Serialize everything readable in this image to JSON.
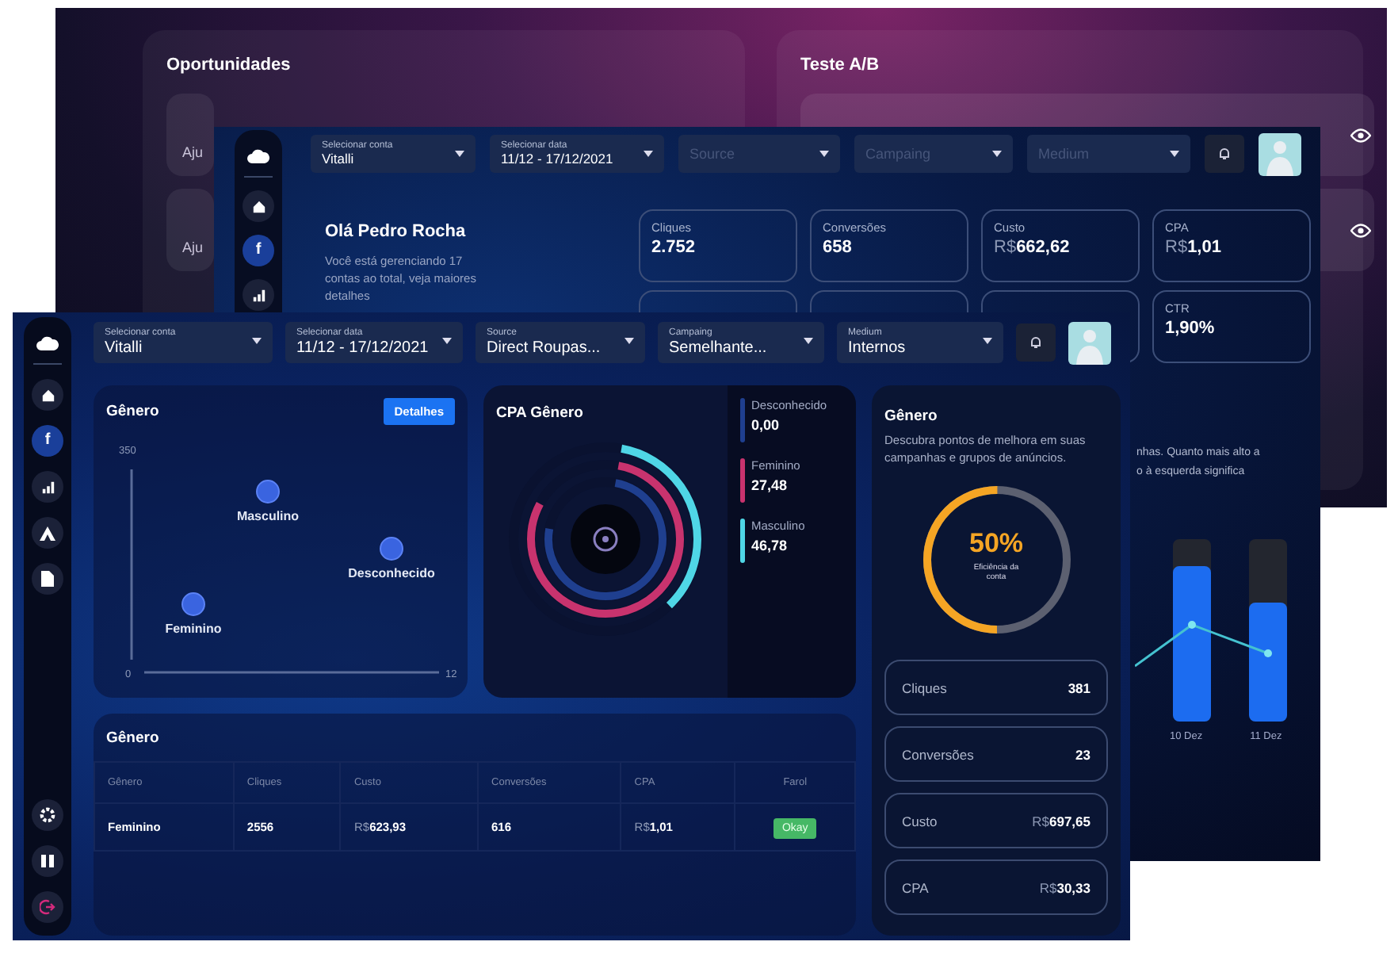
{
  "back_window": {
    "opportunities": {
      "title": "Oportunidades",
      "items": [
        {
          "text": "Aju"
        },
        {
          "text": "Aju"
        }
      ]
    },
    "ab_test": {
      "title": "Teste A/B"
    }
  },
  "middle_window": {
    "sidebar": [
      {
        "kind": "home",
        "selected": false
      },
      {
        "kind": "facebook",
        "glyph": "f",
        "selected": true
      },
      {
        "kind": "chart",
        "selected": false
      }
    ],
    "filters": [
      {
        "label": "Selecionar conta",
        "value": "Vitalli"
      },
      {
        "label": "Selecionar data",
        "value": "11/12 - 17/12/2021"
      },
      {
        "placeholder": "Source"
      },
      {
        "placeholder": "Campaing"
      },
      {
        "placeholder": "Medium"
      }
    ],
    "greeting": {
      "title": "Olá Pedro Rocha",
      "text": "Você está gerenciando 17 contas ao total, veja maiores detalhes"
    },
    "stats": [
      {
        "label": "Cliques",
        "value": "2.752"
      },
      {
        "label": "Conversões",
        "value": "658"
      },
      {
        "label": "Custo",
        "currency": "R$",
        "value": "662,62"
      },
      {
        "label": "CPA",
        "currency": "R$",
        "value": "1,01"
      },
      {
        "label": "CTR",
        "value": "1,90%"
      }
    ],
    "chart_note": [
      "nhas. Quanto mais alto a",
      "o à esquerda significa"
    ],
    "bar_labels": [
      "10 Dez",
      "11 Dez"
    ]
  },
  "front_window": {
    "sidebar": [
      {
        "kind": "home",
        "selected": false
      },
      {
        "kind": "facebook",
        "glyph": "f",
        "selected": true
      },
      {
        "kind": "chart",
        "selected": false
      },
      {
        "kind": "ads",
        "selected": false
      },
      {
        "kind": "document",
        "selected": false
      }
    ],
    "sidebar_bottom": [
      {
        "kind": "settings"
      },
      {
        "kind": "pause"
      },
      {
        "kind": "logout"
      }
    ],
    "filters": [
      {
        "label": "Selecionar conta",
        "value": "Vitalli"
      },
      {
        "label": "Selecionar data",
        "value": "11/12 - 17/12/2021"
      },
      {
        "label": "Source",
        "value": "Direct Roupas..."
      },
      {
        "label": "Campaing",
        "value": "Semelhante..."
      },
      {
        "label": "Medium",
        "value": "Internos"
      }
    ],
    "scatter_panel": {
      "title": "Gênero",
      "button": "Detalhes",
      "axis_labels": [
        "350",
        "0",
        "12"
      ],
      "points": [
        {
          "label": "Masculino"
        },
        {
          "label": "Desconhecido"
        },
        {
          "label": "Feminino"
        }
      ]
    },
    "cpa_panel": {
      "title": "CPA Gênero",
      "legend": [
        {
          "name": "Desconhecido",
          "value": "0,00",
          "color": "#1f3f8f"
        },
        {
          "name": "Feminino",
          "value": "27,48",
          "color": "#c8336e"
        },
        {
          "name": "Masculino",
          "value": "46,78",
          "color": "#4fd6e6"
        }
      ]
    },
    "summary_panel": {
      "title": "Gênero",
      "text": "Descubra pontos de melhora em suas campanhas e grupos de anúncios.",
      "gauge": {
        "level": 0.5,
        "value": "50%",
        "caption": "Eficiência da conta"
      },
      "metrics": [
        {
          "label": "Cliques",
          "value": "381"
        },
        {
          "label": "Conversões",
          "value": "23"
        },
        {
          "label": "Custo",
          "currency": "R$",
          "value": "697,65"
        },
        {
          "label": "CPA",
          "currency": "R$",
          "value": "30,33"
        }
      ]
    },
    "table": {
      "title": "Gênero",
      "columns": [
        "Gênero",
        "Cliques",
        "Custo",
        "Conversões",
        "CPA",
        "Farol"
      ],
      "rows": [
        {
          "cells": [
            {
              "kind": "strong",
              "text": "Feminino"
            },
            {
              "kind": "text",
              "text": "2556"
            },
            {
              "kind": "money",
              "currency": "R$",
              "text": "623,93"
            },
            {
              "kind": "text",
              "text": "616"
            },
            {
              "kind": "money",
              "currency": "R$",
              "text": "1,01"
            },
            {
              "kind": "badge",
              "text": "Okay"
            }
          ]
        }
      ]
    }
  }
}
